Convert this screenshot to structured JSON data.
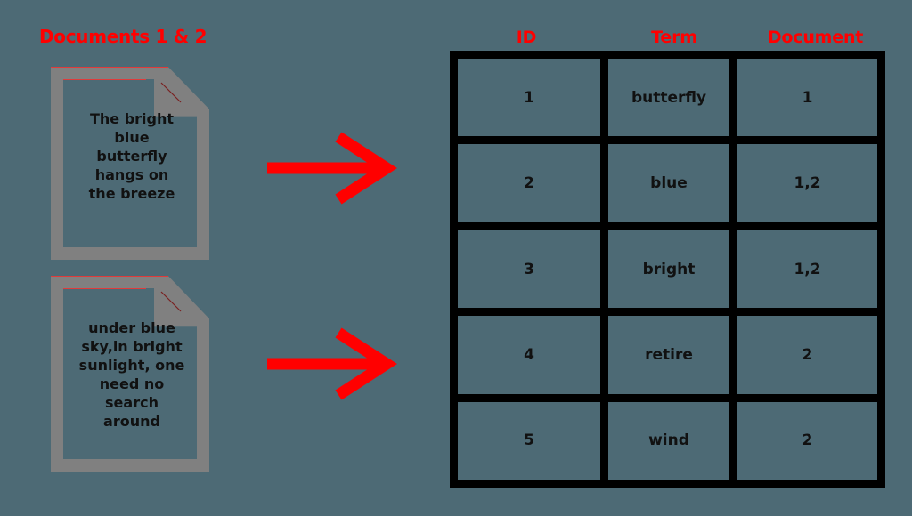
{
  "background_color": "#4d6a75",
  "accent_color": "#ff0000",
  "documents_panel": {
    "heading": "Documents 1 & 2",
    "documents": [
      {
        "name": "document-1",
        "text": "The bright\nblue\nbutterfly\nhangs on\nthe breeze"
      },
      {
        "name": "document-2",
        "text": "under blue\nsky,in bright\nsunlight, one\nneed no\nsearch\naround"
      }
    ],
    "arrows": [
      {
        "name": "arrow-document-1",
        "direction": "right",
        "color": "#ff0000"
      },
      {
        "name": "arrow-document-2",
        "direction": "right",
        "color": "#ff0000"
      }
    ]
  },
  "index_table": {
    "headers": [
      "ID",
      "Term",
      "Document"
    ],
    "rows": [
      {
        "id": "1",
        "term": "butterfly",
        "document": "1"
      },
      {
        "id": "2",
        "term": "blue",
        "document": "1,2"
      },
      {
        "id": "3",
        "term": "bright",
        "document": "1,2"
      },
      {
        "id": "4",
        "term": "retire",
        "document": "2"
      },
      {
        "id": "5",
        "term": "wind",
        "document": "2"
      }
    ]
  },
  "chart_data": {
    "type": "table",
    "title": "Documents 1 & 2",
    "columns": [
      "ID",
      "Term",
      "Document"
    ],
    "rows": [
      [
        "1",
        "butterfly",
        "1"
      ],
      [
        "2",
        "blue",
        "1,2"
      ],
      [
        "3",
        "bright",
        "1,2"
      ],
      [
        "4",
        "retire",
        "2"
      ],
      [
        "5",
        "wind",
        "2"
      ]
    ]
  }
}
